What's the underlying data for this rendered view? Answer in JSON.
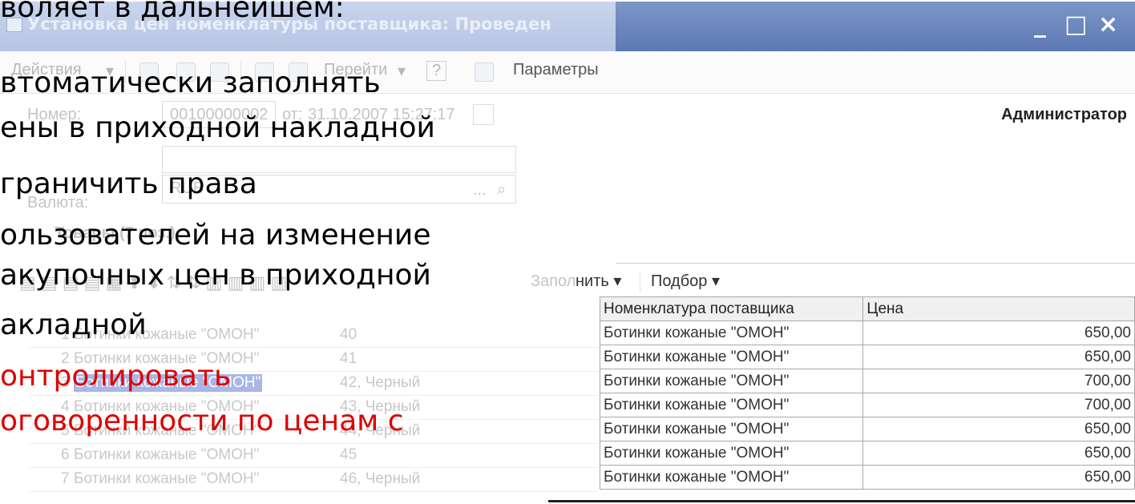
{
  "window": {
    "title": "Установка цен номенклатуры поставщика: Проведен",
    "controls": {
      "minimize": "_",
      "maximize": "□",
      "close": "×"
    }
  },
  "toolbar": {
    "actions_label": "Действия",
    "goto_label": "Перейти",
    "help_label": "?",
    "params_label": "Параметры"
  },
  "form": {
    "number_label": "Номер:",
    "number_value": "00100000002",
    "date_label": "от:",
    "date_value": "31.10.2007 15:27:17",
    "currency_label": "Валюта:",
    "currency_value": "RUB",
    "user": "Администратор",
    "goods_section": "Товары (7 поз.)",
    "fill_button": "Заполнить",
    "selection_button": "Подбор"
  },
  "table": {
    "headers": [
      "Номенклатура поставщика",
      "Цена"
    ],
    "rows": [
      {
        "n": "1",
        "name": "Ботинки кожаные \"ОМОН\"",
        "char": "40",
        "supplier_item": "Ботинки кожаные \"ОМОН\"",
        "price": "650,00"
      },
      {
        "n": "2",
        "name": "Ботинки кожаные \"ОМОН\"",
        "char": "41",
        "supplier_item": "Ботинки кожаные \"ОМОН\"",
        "price": "650,00"
      },
      {
        "n": "3",
        "name": "Ботинки кожаные \"ОМОН\"",
        "char": "42, Черный",
        "supplier_item": "Ботинки кожаные \"ОМОН\"",
        "price": "700,00"
      },
      {
        "n": "4",
        "name": "Ботинки кожаные \"ОМОН\"",
        "char": "43, Черный",
        "supplier_item": "Ботинки кожаные \"ОМОН\"",
        "price": "700,00"
      },
      {
        "n": "5",
        "name": "Ботинки кожаные \"ОМОН\"",
        "char": "44, Черный",
        "supplier_item": "Ботинки кожаные \"ОМОН\"",
        "price": "650,00"
      },
      {
        "n": "6",
        "name": "Ботинки кожаные \"ОМОН\"",
        "char": "45",
        "supplier_item": "Ботинки кожаные \"ОМОН\"",
        "price": "650,00"
      },
      {
        "n": "7",
        "name": "Ботинки кожаные \"ОМОН\"",
        "char": "46, Черный",
        "supplier_item": "Ботинки кожаные \"ОМОН\"",
        "price": "650,00"
      }
    ]
  },
  "slide": {
    "heading": "воляет в дальнейшем:",
    "lines": [
      {
        "text": "втоматически заполнять",
        "color": "#000000"
      },
      {
        "text": "ены в приходной накладной",
        "color": "#000000"
      },
      {
        "text": "граничить права",
        "color": "#000000"
      },
      {
        "text": "ользователей на изменение",
        "color": "#000000"
      },
      {
        "text": "акупочных цен в приходной",
        "color": "#000000"
      },
      {
        "text": "акладной",
        "color": "#000000"
      },
      {
        "text": "онтролировать",
        "color": "#dd0000"
      },
      {
        "text": "оговоренности по ценам с",
        "color": "#dd0000"
      }
    ]
  }
}
